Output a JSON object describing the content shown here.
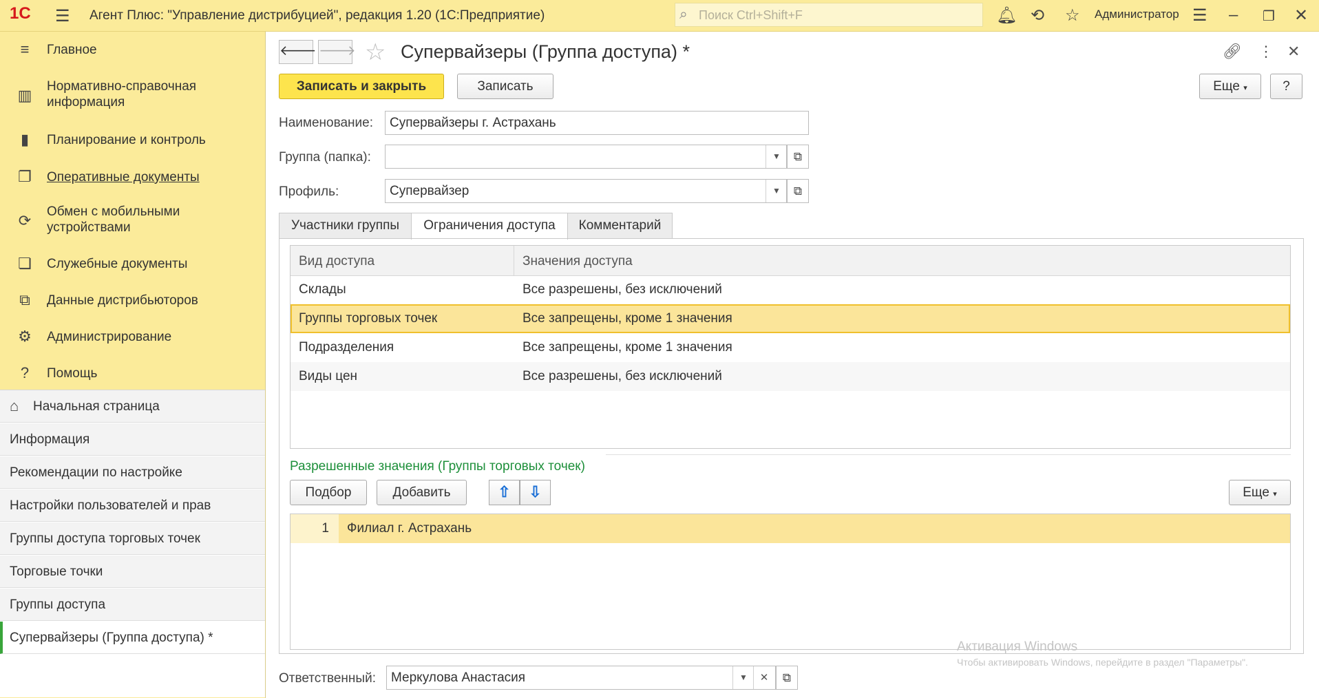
{
  "titlebar": {
    "logo": "1С",
    "title": "Агент Плюс: \"Управление дистрибуцией\", редакция 1.20  (1С:Предприятие)",
    "search_placeholder": "Поиск Ctrl+Shift+F",
    "user": "Администратор"
  },
  "sidebar": {
    "sections": [
      {
        "label": "Главное",
        "icon": "menu-icon"
      },
      {
        "label": "Нормативно-справочная",
        "label2": "информация",
        "icon": "library-icon"
      },
      {
        "label": "Планирование и контроль",
        "icon": "chart-icon"
      },
      {
        "label": "Оперативные документы",
        "icon": "documents-icon"
      },
      {
        "label": "Обмен с мобильными",
        "label2": "устройствами",
        "icon": "sync-icon"
      },
      {
        "label": "Служебные документы",
        "icon": "service-docs-icon"
      },
      {
        "label": "Данные дистрибьюторов",
        "icon": "distributor-icon"
      },
      {
        "label": "Администрирование",
        "icon": "gear-icon"
      },
      {
        "label": "Помощь",
        "icon": "help-icon"
      }
    ],
    "open_windows": [
      "Начальная страница",
      "Информация",
      "Рекомендации по настройке",
      "Настройки пользователей и прав",
      "Группы доступа торговых точек",
      "Торговые точки",
      "Группы доступа",
      "Супервайзеры (Группа доступа) *"
    ]
  },
  "form": {
    "title": "Супервайзеры (Группа доступа) *",
    "save_close": "Записать и закрыть",
    "save": "Записать",
    "more": "Еще",
    "help": "?",
    "name_label": "Наименование:",
    "name_value": "Супервайзеры г. Астрахань",
    "group_label": "Группа (папка):",
    "group_value": "",
    "profile_label": "Профиль:",
    "profile_value": "Супервайзер",
    "tabs": [
      "Участники группы",
      "Ограничения доступа",
      "Комментарий"
    ],
    "access_table": {
      "columns": [
        "Вид доступа",
        "Значения доступа"
      ],
      "rows": [
        [
          "Склады",
          "Все разрешены, без исключений"
        ],
        [
          "Группы торговых точек",
          "Все запрещены, кроме 1 значения"
        ],
        [
          "Подразделения",
          "Все запрещены, кроме 1 значения"
        ],
        [
          "Виды цен",
          "Все разрешены, без исключений"
        ]
      ]
    },
    "allowed_title": "Разрешенные значения (Группы торговых точек)",
    "pick": "Подбор",
    "add": "Добавить",
    "more2": "Еще",
    "allowed_rows": [
      [
        "1",
        "Филиал г. Астрахань"
      ]
    ],
    "responsible_label": "Ответственный:",
    "responsible_value": "Меркулова Анастасия"
  },
  "watermark": {
    "line1": "Активация Windows",
    "line2": "Чтобы активировать Windows, перейдите в раздел \"Параметры\"."
  }
}
